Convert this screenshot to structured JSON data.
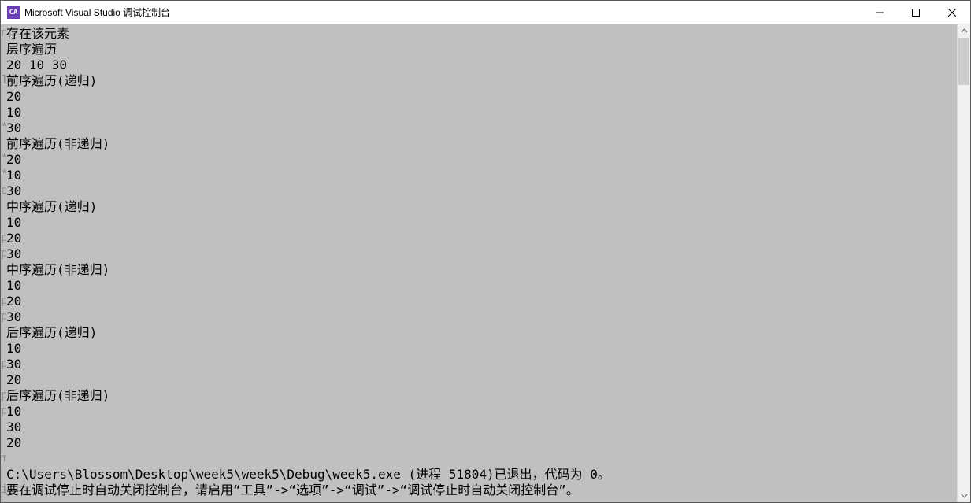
{
  "window": {
    "icon_text": "CA",
    "title": "Microsoft Visual Studio 调试控制台"
  },
  "gutter_marks": "n\n \n \nl\n \n \n*\n \n*\n*\ne\n \n \np\np\n \n \np\np\n \n \np\n \np\np\n \n \nm\n \ni\n \n \n",
  "console_lines": [
    "存在该元素",
    "层序遍历",
    "20 10 30",
    "前序遍历(递归)",
    "20",
    "10",
    "30",
    "前序遍历(非递归)",
    "20",
    "10",
    "30",
    "中序遍历(递归)",
    "10",
    "20",
    "30",
    "中序遍历(非递归)",
    "10",
    "20",
    "30",
    "后序遍历(递归)",
    "10",
    "30",
    "20",
    "后序遍历(非递归)",
    "10",
    "30",
    "20",
    "",
    "C:\\Users\\Blossom\\Desktop\\week5\\week5\\Debug\\week5.exe (进程 51804)已退出，代码为 0。",
    "要在调试停止时自动关闭控制台，请启用“工具”->“选项”->“调试”->“调试停止时自动关闭控制台”。"
  ]
}
